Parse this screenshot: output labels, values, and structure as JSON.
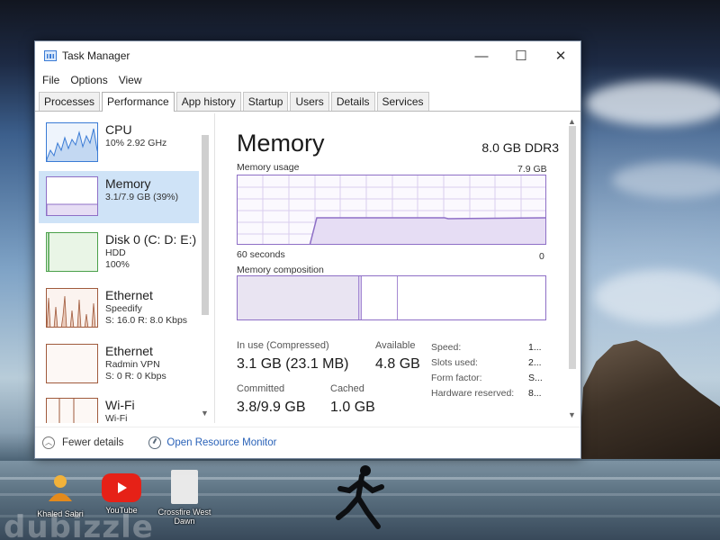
{
  "window": {
    "title": "Task Manager",
    "controls": {
      "minimize": "—",
      "maximize": "☐",
      "close": "✕"
    }
  },
  "menu": [
    "File",
    "Options",
    "View"
  ],
  "tabs": [
    "Processes",
    "Performance",
    "App history",
    "Startup",
    "Users",
    "Details",
    "Services"
  ],
  "active_tab": "Performance",
  "sidebar": {
    "items": [
      {
        "title": "CPU",
        "line1": "10% 2.92 GHz",
        "line2": "",
        "selected": false,
        "graph": "cpu"
      },
      {
        "title": "Memory",
        "line1": "3.1/7.9 GB (39%)",
        "line2": "",
        "selected": true,
        "graph": "memory"
      },
      {
        "title": "Disk 0 (C: D: E:)",
        "line1": "HDD",
        "line2": "100%",
        "selected": false,
        "graph": "disk"
      },
      {
        "title": "Ethernet",
        "line1": "Speedify",
        "line2": "S: 16.0  R: 8.0 Kbps",
        "selected": false,
        "graph": "eth1"
      },
      {
        "title": "Ethernet",
        "line1": "Radmin VPN",
        "line2": "S: 0  R: 0 Kbps",
        "selected": false,
        "graph": "eth2"
      },
      {
        "title": "Wi-Fi",
        "line1": "Wi-Fi",
        "line2": "",
        "selected": false,
        "graph": "wifi"
      }
    ]
  },
  "memory": {
    "heading": "Memory",
    "spec": "8.0 GB DDR3",
    "usage_label": "Memory usage",
    "usage_max": "7.9 GB",
    "time_left": "60 seconds",
    "time_right": "0",
    "composition_label": "Memory composition",
    "stats": {
      "in_use_label": "In use (Compressed)",
      "in_use_value": "3.1 GB (23.1 MB)",
      "available_label": "Available",
      "available_value": "4.8 GB",
      "committed_label": "Committed",
      "committed_value": "3.8/9.9 GB",
      "cached_label": "Cached",
      "cached_value": "1.0 GB"
    },
    "details": [
      {
        "label": "Speed:",
        "value": "1..."
      },
      {
        "label": "Slots used:",
        "value": "2..."
      },
      {
        "label": "Form factor:",
        "value": "S..."
      },
      {
        "label": "Hardware reserved:",
        "value": "8..."
      }
    ]
  },
  "footer": {
    "fewer_details": "Fewer details",
    "open_resource_monitor": "Open Resource Monitor"
  },
  "desktop": {
    "icons": [
      "Khaled Sabri",
      "YouTube",
      "Crossfire West Dawn"
    ],
    "watermark": "dubizzle"
  },
  "colors": {
    "memory_accent": "#8e6fc6",
    "cpu_accent": "#3a7bd5",
    "disk_accent": "#4aa04a",
    "network_accent": "#a05a3c",
    "selected_bg": "#cfe3f7",
    "link": "#2a62b8"
  }
}
